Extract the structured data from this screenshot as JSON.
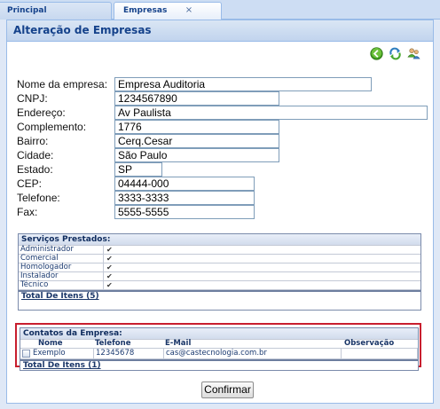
{
  "tabs": [
    {
      "label": "Principal"
    },
    {
      "label": "Empresas",
      "close": "×"
    }
  ],
  "panel": {
    "title": "Alteração de Empresas"
  },
  "toolbar_icons": [
    "back-icon",
    "refresh-icon",
    "users-icon"
  ],
  "form": {
    "nome": {
      "label": "Nome da empresa:",
      "value": "Empresa Auditoria"
    },
    "cnpj": {
      "label": "CNPJ:",
      "value": "1234567890"
    },
    "endereco": {
      "label": "Endereço:",
      "value": "Av Paulista"
    },
    "complemento": {
      "label": "Complemento:",
      "value": "1776"
    },
    "bairro": {
      "label": "Bairro:",
      "value": "Cerq.Cesar"
    },
    "cidade": {
      "label": "Cidade:",
      "value": "São Paulo"
    },
    "estado": {
      "label": "Estado:",
      "value": "SP"
    },
    "cep": {
      "label": "CEP:",
      "value": "04444-000"
    },
    "telefone": {
      "label": "Telefone:",
      "value": "3333-3333"
    },
    "fax": {
      "label": "Fax:",
      "value": "5555-5555"
    }
  },
  "servicos": {
    "title": "Serviços Prestados:",
    "items": [
      {
        "name": "Administrador",
        "check": "✔"
      },
      {
        "name": "Comercial",
        "check": "✔"
      },
      {
        "name": "Homologador",
        "check": "✔"
      },
      {
        "name": "Instalador",
        "check": "✔"
      },
      {
        "name": "Técnico",
        "check": "✔"
      }
    ],
    "footer": "Total De Itens (5)"
  },
  "contatos": {
    "title": "Contatos da Empresa:",
    "columns": {
      "nome": "Nome",
      "telefone": "Telefone",
      "email": "E-Mail",
      "observacao": "Observação"
    },
    "rows": [
      {
        "nome": "Exemplo",
        "telefone": "12345678",
        "email": "cas@castecnologia.com.br",
        "observacao": ""
      }
    ],
    "footer": "Total De Itens (1)"
  },
  "confirm_label": "Confirmar",
  "colors": {
    "header_text": "#15428b",
    "highlight_border": "#c81e2e",
    "panel_bg": "#dfe8f6"
  }
}
